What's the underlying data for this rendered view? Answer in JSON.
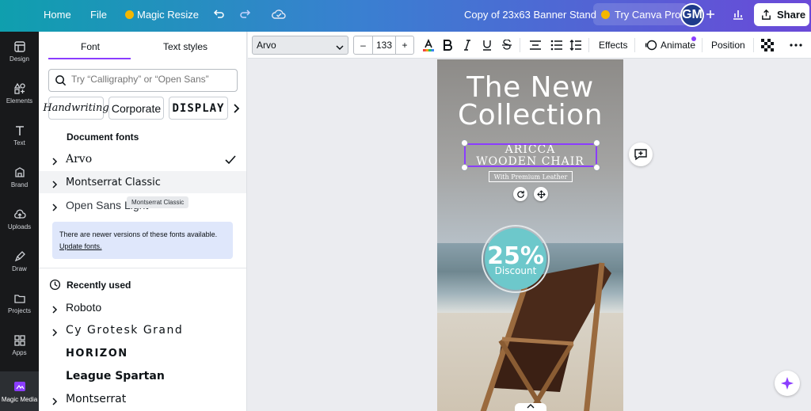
{
  "topbar": {
    "home": "Home",
    "file": "File",
    "magic_resize": "Magic Resize",
    "doc_title": "Copy of 23x63  Banner Stand",
    "try_pro": "Try Canva Pro",
    "avatar_initials": "GM",
    "share": "Share"
  },
  "rail": {
    "items": [
      {
        "label": "Design",
        "icon": "design-icon"
      },
      {
        "label": "Elements",
        "icon": "elements-icon"
      },
      {
        "label": "Text",
        "icon": "text-icon"
      },
      {
        "label": "Brand",
        "icon": "brand-icon"
      },
      {
        "label": "Uploads",
        "icon": "uploads-icon"
      },
      {
        "label": "Draw",
        "icon": "draw-icon"
      },
      {
        "label": "Projects",
        "icon": "projects-icon"
      },
      {
        "label": "Apps",
        "icon": "apps-icon"
      },
      {
        "label": "Magic Media",
        "icon": "magic-media-icon"
      }
    ]
  },
  "panel": {
    "tab_font": "Font",
    "tab_text_styles": "Text styles",
    "search_placeholder": "Try “Calligraphy” or “Open Sans”",
    "chips": [
      "Handwriting",
      "Corporate",
      "DISPLAY"
    ],
    "document_fonts_heading": "Document fonts",
    "document_fonts": [
      "Arvo",
      "Montserrat Classic",
      "Open Sans Light"
    ],
    "tooltip": "Montserrat Classic",
    "notice_text": "There are newer versions of these fonts available.",
    "notice_link": "Update fonts.",
    "recently_used_heading": "Recently used",
    "recent_fonts": [
      "Roboto",
      "Cy Grotesk Grand",
      "HORIZON",
      "League Spartan",
      "Montserrat"
    ]
  },
  "toolbar": {
    "font_name": "Arvo",
    "minus": "–",
    "font_size": "133",
    "plus": "+",
    "effects": "Effects",
    "animate": "Animate",
    "position": "Position"
  },
  "design": {
    "headline_line1": "The New",
    "headline_line2": "Collection",
    "sub_line1": "ARICCA",
    "sub_line2": "WOODEN CHAIR",
    "premium": "With Premium Leather",
    "percent": "25%",
    "discount": "Discount"
  },
  "colors": {
    "accent": "#8b3dff",
    "badge": "#6dc8cb",
    "rail_bg": "#18191b"
  }
}
